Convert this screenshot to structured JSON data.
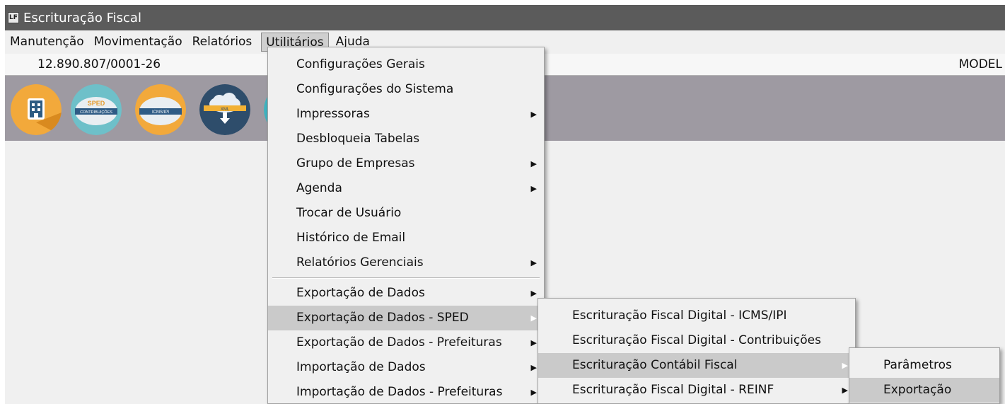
{
  "window": {
    "title": "Escrituração Fiscal",
    "icon_text": "LF"
  },
  "menubar": {
    "items": [
      {
        "label": "Manutenção"
      },
      {
        "label": "Movimentação"
      },
      {
        "label": "Relatórios"
      },
      {
        "label": "Utilitários"
      },
      {
        "label": "Ajuda"
      }
    ]
  },
  "status": {
    "cnpj": "12.890.807/0001-26",
    "model": "MODEL"
  },
  "toolbar": {
    "icons": [
      {
        "name": "company-icon"
      },
      {
        "name": "sped-contribuicoes-icon",
        "text_top": "SPED",
        "text_bottom": "CONTRIBUIÇÕES"
      },
      {
        "name": "icms-ipi-icon",
        "text": "ICMS/IPI"
      },
      {
        "name": "xml-download-icon",
        "text": "XML"
      },
      {
        "name": "partial-icon"
      }
    ]
  },
  "utilitarios_menu": {
    "items": [
      {
        "label": "Configurações Gerais",
        "submenu": false
      },
      {
        "label": "Configurações do Sistema",
        "submenu": false
      },
      {
        "label": "Impressoras",
        "submenu": true
      },
      {
        "label": "Desbloqueia Tabelas",
        "submenu": false
      },
      {
        "label": "Grupo de Empresas",
        "submenu": true
      },
      {
        "label": "Agenda",
        "submenu": true
      },
      {
        "label": "Trocar de Usuário",
        "submenu": false
      },
      {
        "label": "Histórico de Email",
        "submenu": false
      },
      {
        "label": "Relatórios Gerenciais",
        "submenu": true
      },
      {
        "label": "Exportação de Dados",
        "submenu": true
      },
      {
        "label": "Exportação de Dados - SPED",
        "submenu": true,
        "selected": true
      },
      {
        "label": "Exportação de Dados - Prefeituras",
        "submenu": true
      },
      {
        "label": "Importação de Dados",
        "submenu": true
      },
      {
        "label": "Importação de Dados - Prefeituras",
        "submenu": true
      }
    ]
  },
  "sped_menu": {
    "items": [
      {
        "label": "Escrituração Fiscal Digital - ICMS/IPI",
        "submenu": false
      },
      {
        "label": "Escrituração Fiscal Digital - Contribuições",
        "submenu": false
      },
      {
        "label": "Escrituração Contábil Fiscal",
        "submenu": true,
        "selected": true
      },
      {
        "label": "Escrituração Fiscal Digital - REINF",
        "submenu": true
      }
    ]
  },
  "ecf_menu": {
    "items": [
      {
        "label": "Parâmetros"
      },
      {
        "label": "Exportação",
        "selected": true
      }
    ]
  },
  "arrow_glyph": "▶"
}
